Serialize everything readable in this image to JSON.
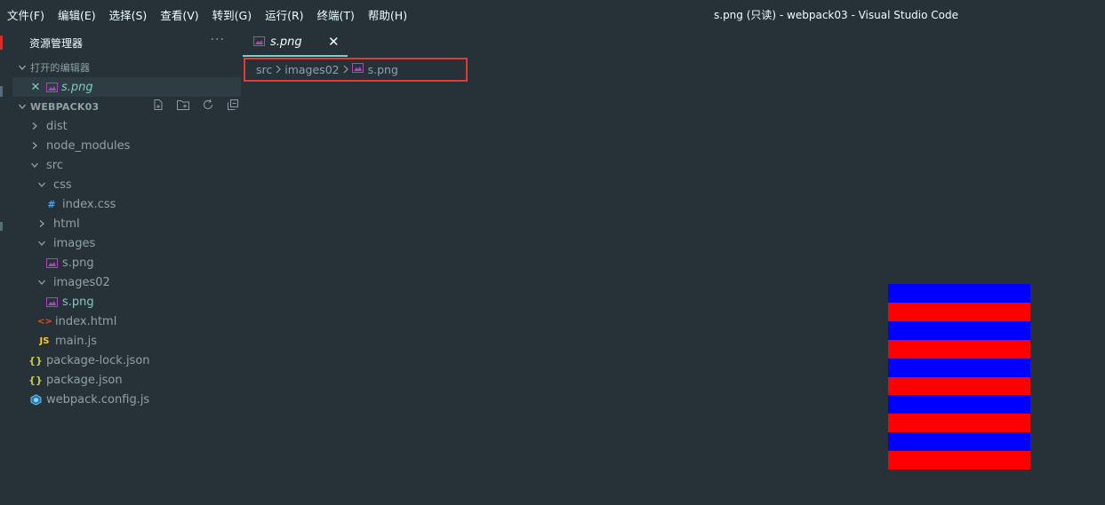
{
  "menu": [
    "文件(F)",
    "编辑(E)",
    "选择(S)",
    "查看(V)",
    "转到(G)",
    "运行(R)",
    "终端(T)",
    "帮助(H)"
  ],
  "window_title": "s.png (只读) - webpack03 - Visual Studio Code",
  "sidebar": {
    "title": "资源管理器",
    "more": "···",
    "open_editors": {
      "label": "打开的编辑器",
      "items": [
        {
          "label": "s.png",
          "close": "✕"
        }
      ]
    },
    "workspace": {
      "label": "WEBPACK03",
      "tree": [
        {
          "label": "dist",
          "kind": "folder",
          "state": "collapsed",
          "depth": 1
        },
        {
          "label": "node_modules",
          "kind": "folder",
          "state": "collapsed",
          "depth": 1
        },
        {
          "label": "src",
          "kind": "folder",
          "state": "expanded",
          "depth": 1
        },
        {
          "label": "css",
          "kind": "folder",
          "state": "expanded",
          "depth": 2
        },
        {
          "label": "index.css",
          "kind": "css",
          "depth": 3
        },
        {
          "label": "html",
          "kind": "folder",
          "state": "collapsed",
          "depth": 2
        },
        {
          "label": "images",
          "kind": "folder",
          "state": "expanded",
          "depth": 2
        },
        {
          "label": "s.png",
          "kind": "image",
          "depth": 3
        },
        {
          "label": "images02",
          "kind": "folder",
          "state": "expanded",
          "depth": 2
        },
        {
          "label": "s.png",
          "kind": "image",
          "depth": 3,
          "active": true
        },
        {
          "label": "index.html",
          "kind": "html",
          "depth": 2
        },
        {
          "label": "main.js",
          "kind": "js",
          "depth": 2
        },
        {
          "label": "package-lock.json",
          "kind": "json",
          "depth": 1
        },
        {
          "label": "package.json",
          "kind": "json",
          "depth": 1
        },
        {
          "label": "webpack.config.js",
          "kind": "webpack",
          "depth": 1
        }
      ]
    }
  },
  "tab": {
    "label": "s.png",
    "close": "✕"
  },
  "breadcrumb": [
    "src",
    "images02",
    "s.png"
  ],
  "preview": {
    "stripes": [
      "#0000ff",
      "#ff0000",
      "#0000ff",
      "#ff0000",
      "#0000ff",
      "#ff0000",
      "#0000ff",
      "#ff0000",
      "#0000ff",
      "#ff0000"
    ]
  },
  "colors": {
    "accent": "#80cbc4",
    "highlight_box": "#e53935",
    "background": "#263238"
  }
}
